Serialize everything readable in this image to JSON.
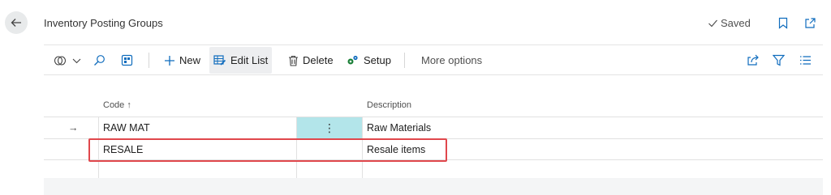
{
  "header": {
    "title": "Inventory Posting Groups",
    "saved_label": "Saved"
  },
  "toolbar": {
    "new_label": "New",
    "edit_list_label": "Edit List",
    "delete_label": "Delete",
    "setup_label": "Setup",
    "more_options_label": "More options"
  },
  "table": {
    "columns": {
      "code": "Code",
      "code_sort": "↑",
      "description": "Description"
    },
    "rows": [
      {
        "indicator": "→",
        "code": "RAW MAT",
        "menu": "⋮",
        "description": "Raw Materials",
        "selected": true
      },
      {
        "indicator": "",
        "code": "RESALE",
        "menu": "",
        "description": "Resale items",
        "selected": false
      },
      {
        "indicator": "",
        "code": "",
        "menu": "",
        "description": "",
        "selected": false
      }
    ]
  },
  "colors": {
    "accent": "#0f6cbd",
    "selected_cell": "#b3e5ea",
    "highlight": "#e0474c"
  },
  "icons": [
    "back-arrow-icon",
    "checkmark-icon",
    "bookmark-icon",
    "open-new-window-icon",
    "analysis-icon",
    "chevron-down-icon",
    "search-icon",
    "filter-pane-icon",
    "plus-icon",
    "edit-list-icon",
    "trash-icon",
    "setup-icon",
    "share-icon",
    "filter-icon",
    "list-view-icon"
  ]
}
